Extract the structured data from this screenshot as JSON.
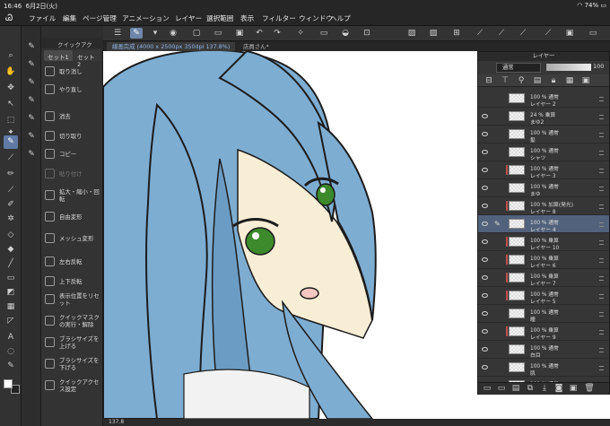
{
  "status": {
    "time": "16:46",
    "date": "6月2日(火)",
    "battery": "74%"
  },
  "menu": [
    "ファイル",
    "編集",
    "ページ管理",
    "アニメーション",
    "レイヤー",
    "選択範囲",
    "表示",
    "フィルター",
    "ウィンドウ",
    "ヘルプ"
  ],
  "quick_access": {
    "title": "クイックアク",
    "tabs": [
      "セット1",
      "セット2"
    ],
    "items": [
      {
        "label": "取り消し",
        "icon": "undo-icon",
        "enabled": true
      },
      {
        "label": "やり直し",
        "icon": "redo-icon",
        "enabled": true
      },
      {
        "label": "消去",
        "icon": "erase-icon",
        "enabled": true
      },
      {
        "label": "切り取り",
        "icon": "scissors-icon",
        "enabled": true
      },
      {
        "label": "コピー",
        "icon": "copy-icon",
        "enabled": true
      },
      {
        "label": "貼り付け",
        "icon": "paste-icon",
        "enabled": false
      },
      {
        "label": "拡大・縮小・回転",
        "icon": "scale-rotate-icon",
        "enabled": true
      },
      {
        "label": "自由変形",
        "icon": "free-transform-icon",
        "enabled": true
      },
      {
        "label": "メッシュ変形",
        "icon": "mesh-transform-icon",
        "enabled": true
      },
      {
        "label": "左右反転",
        "icon": "flip-horizontal-icon",
        "enabled": true
      },
      {
        "label": "上下反転",
        "icon": "flip-vertical-icon",
        "enabled": true
      },
      {
        "label": "表示位置をリセット",
        "icon": "reset-view-icon",
        "enabled": true
      },
      {
        "label": "クイックマスクの実行・解除",
        "icon": "quick-mask-icon",
        "enabled": true
      },
      {
        "label": "ブラシサイズを上げる",
        "icon": "brush-size-up-icon",
        "enabled": true
      },
      {
        "label": "ブラシサイズを下げる",
        "icon": "brush-size-down-icon",
        "enabled": true
      },
      {
        "label": "クイックアクセス設定",
        "icon": "settings-icon",
        "enabled": true
      }
    ]
  },
  "document_tabs": [
    "線画完成 (4000 x 2500px 350dpi 137.8%)",
    "店員さん*"
  ],
  "zoom": "137.8",
  "layer_panel": {
    "title": "レイヤー",
    "blend_mode": "通常",
    "opacity": "100",
    "layers": [
      {
        "mode": "100 % 通常",
        "name": "レイヤー 2",
        "selected": false,
        "marked": false,
        "visible": false
      },
      {
        "mode": "24 % 乗算",
        "name": "まゆ2",
        "selected": false,
        "marked": false,
        "visible": true
      },
      {
        "mode": "100 % 通常",
        "name": "髪",
        "selected": false,
        "marked": false,
        "visible": true
      },
      {
        "mode": "100 % 通常",
        "name": "シャツ",
        "selected": false,
        "marked": false,
        "visible": true
      },
      {
        "mode": "100 % 通常",
        "name": "レイヤー 3",
        "selected": false,
        "marked": true,
        "visible": true
      },
      {
        "mode": "100 % 通常",
        "name": "まゆ",
        "selected": false,
        "marked": false,
        "visible": true
      },
      {
        "mode": "100 % 加算(発光)",
        "name": "レイヤー 8",
        "selected": false,
        "marked": true,
        "visible": true
      },
      {
        "mode": "100 % 通常",
        "name": "レイヤー 4",
        "selected": true,
        "marked": false,
        "visible": true
      },
      {
        "mode": "100 % 乗算",
        "name": "レイヤー 10",
        "selected": false,
        "marked": true,
        "visible": true
      },
      {
        "mode": "100 % 乗算",
        "name": "レイヤー 6",
        "selected": false,
        "marked": true,
        "visible": true
      },
      {
        "mode": "100 % 乗算",
        "name": "レイヤー 7",
        "selected": false,
        "marked": true,
        "visible": true
      },
      {
        "mode": "100 % 通常",
        "name": "レイヤー 5",
        "selected": false,
        "marked": true,
        "visible": true
      },
      {
        "mode": "100 % 通常",
        "name": "瞳",
        "selected": false,
        "marked": false,
        "visible": true
      },
      {
        "mode": "100 % 乗算",
        "name": "レイヤー 9",
        "selected": false,
        "marked": true,
        "visible": true
      },
      {
        "mode": "100 % 通常",
        "name": "白目",
        "selected": false,
        "marked": false,
        "visible": true
      },
      {
        "mode": "100 % 通常",
        "name": "肌",
        "selected": false,
        "marked": false,
        "visible": true
      },
      {
        "mode": "100 % 通常",
        "name": "リボン",
        "selected": false,
        "marked": false,
        "visible": true
      }
    ]
  },
  "colors": {
    "hair": "#7eadd2",
    "skin": "#f8eed6",
    "eye": "#3c8a2c",
    "selected_row": "#52627c",
    "active_tool": "#5f7ba5"
  }
}
